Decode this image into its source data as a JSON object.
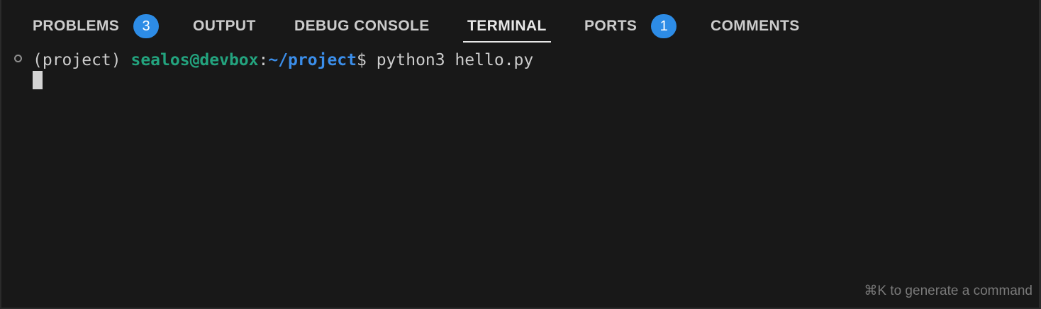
{
  "tabs": [
    {
      "label": "PROBLEMS",
      "badge": "3",
      "active": false
    },
    {
      "label": "OUTPUT",
      "active": false
    },
    {
      "label": "DEBUG CONSOLE",
      "active": false
    },
    {
      "label": "TERMINAL",
      "active": true
    },
    {
      "label": "PORTS",
      "badge": "1",
      "active": false
    },
    {
      "label": "COMMENTS",
      "active": false
    }
  ],
  "terminal": {
    "env": "(project) ",
    "user_host": "sealos@devbox",
    "colon": ":",
    "path": "~/project",
    "dollar": "$ ",
    "command": "python3 hello.py"
  },
  "hint": "⌘K to generate a command",
  "colors": {
    "background": "#181818",
    "badge": "#2d8ce6",
    "user_host": "#23a37e",
    "path": "#3b8eea",
    "text": "#cccccc"
  },
  "icons": {
    "prompt_marker": "circle-outline-icon"
  }
}
